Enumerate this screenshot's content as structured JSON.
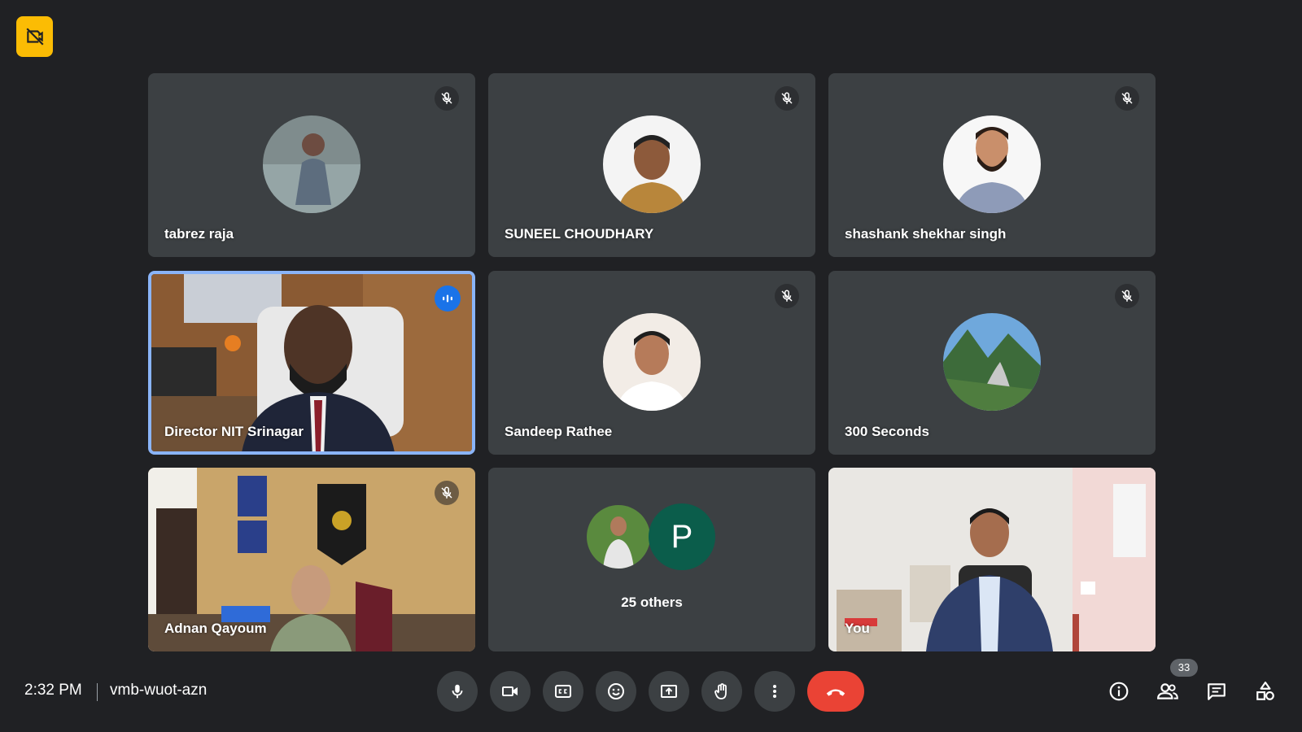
{
  "tiles": [
    {
      "name": "tabrez raja",
      "muted": true
    },
    {
      "name": "SUNEEL CHOUDHARY",
      "muted": true
    },
    {
      "name": "shashank shekhar singh",
      "muted": true
    },
    {
      "name": "Director NIT Srinagar",
      "speaking": true
    },
    {
      "name": "Sandeep Rathee",
      "muted": true
    },
    {
      "name": "300 Seconds",
      "muted": true
    },
    {
      "name": "Adnan Qayoum",
      "muted": true
    },
    {
      "others_label": "25 others",
      "others_initial": "P"
    },
    {
      "name": "You"
    }
  ],
  "bottom_bar": {
    "time": "2:32 PM",
    "meeting_code": "vmb-wuot-azn",
    "people_count": "33"
  },
  "icons": {
    "rec_badge": "camera-off-icon",
    "controls": [
      "mic-icon",
      "camera-icon",
      "captions-icon",
      "emoji-icon",
      "present-screen-icon",
      "raise-hand-icon",
      "more-vert-icon",
      "end-call-icon"
    ],
    "right_controls": [
      "info-icon",
      "people-icon",
      "chat-icon",
      "activities-icon"
    ]
  },
  "colors": {
    "background": "#202124",
    "tile": "#3c4043",
    "active_border": "#8ab4f8",
    "end_call": "#ea4335",
    "badge": "#fbbc04"
  }
}
